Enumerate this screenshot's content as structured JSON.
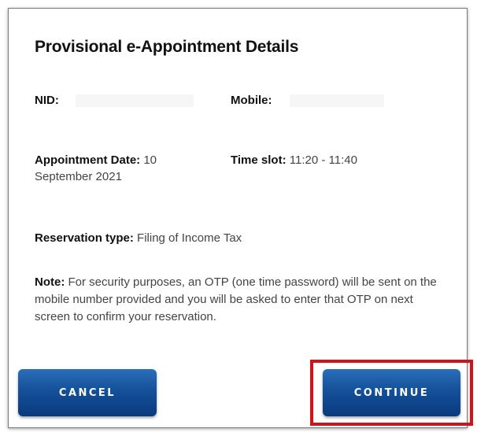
{
  "dialog": {
    "title": "Provisional e-Appointment Details",
    "nid_label": "NID:",
    "mobile_label": "Mobile:",
    "appointment_date_label": "Appointment Date:",
    "appointment_date_value": "10 September 2021",
    "time_slot_label": "Time slot:",
    "time_slot_value": "11:20 - 11:40",
    "reservation_type_label": "Reservation type:",
    "reservation_type_value": "Filing of Income Tax",
    "note_label": "Note:",
    "note_text": "For security purposes, an OTP (one time password) will be sent on the mobile number provided and you will be asked to enter that OTP on next screen to confirm your reservation."
  },
  "buttons": {
    "cancel_label": "CANCEL",
    "continue_label": "CONTINUE"
  },
  "colors": {
    "button_blue": "#14509a",
    "highlight_red": "#d0121b"
  }
}
